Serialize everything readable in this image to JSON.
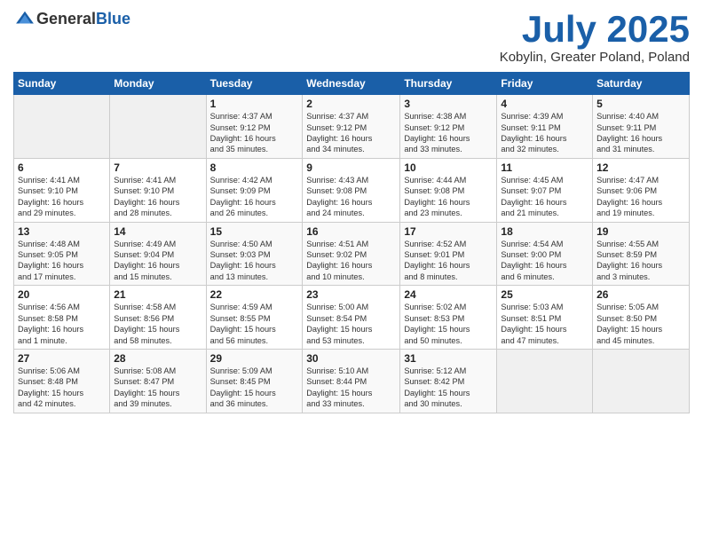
{
  "header": {
    "logo_general": "General",
    "logo_blue": "Blue",
    "month": "July 2025",
    "location": "Kobylin, Greater Poland, Poland"
  },
  "days_of_week": [
    "Sunday",
    "Monday",
    "Tuesday",
    "Wednesday",
    "Thursday",
    "Friday",
    "Saturday"
  ],
  "weeks": [
    [
      {
        "day": "",
        "info": ""
      },
      {
        "day": "",
        "info": ""
      },
      {
        "day": "1",
        "info": "Sunrise: 4:37 AM\nSunset: 9:12 PM\nDaylight: 16 hours\nand 35 minutes."
      },
      {
        "day": "2",
        "info": "Sunrise: 4:37 AM\nSunset: 9:12 PM\nDaylight: 16 hours\nand 34 minutes."
      },
      {
        "day": "3",
        "info": "Sunrise: 4:38 AM\nSunset: 9:12 PM\nDaylight: 16 hours\nand 33 minutes."
      },
      {
        "day": "4",
        "info": "Sunrise: 4:39 AM\nSunset: 9:11 PM\nDaylight: 16 hours\nand 32 minutes."
      },
      {
        "day": "5",
        "info": "Sunrise: 4:40 AM\nSunset: 9:11 PM\nDaylight: 16 hours\nand 31 minutes."
      }
    ],
    [
      {
        "day": "6",
        "info": "Sunrise: 4:41 AM\nSunset: 9:10 PM\nDaylight: 16 hours\nand 29 minutes."
      },
      {
        "day": "7",
        "info": "Sunrise: 4:41 AM\nSunset: 9:10 PM\nDaylight: 16 hours\nand 28 minutes."
      },
      {
        "day": "8",
        "info": "Sunrise: 4:42 AM\nSunset: 9:09 PM\nDaylight: 16 hours\nand 26 minutes."
      },
      {
        "day": "9",
        "info": "Sunrise: 4:43 AM\nSunset: 9:08 PM\nDaylight: 16 hours\nand 24 minutes."
      },
      {
        "day": "10",
        "info": "Sunrise: 4:44 AM\nSunset: 9:08 PM\nDaylight: 16 hours\nand 23 minutes."
      },
      {
        "day": "11",
        "info": "Sunrise: 4:45 AM\nSunset: 9:07 PM\nDaylight: 16 hours\nand 21 minutes."
      },
      {
        "day": "12",
        "info": "Sunrise: 4:47 AM\nSunset: 9:06 PM\nDaylight: 16 hours\nand 19 minutes."
      }
    ],
    [
      {
        "day": "13",
        "info": "Sunrise: 4:48 AM\nSunset: 9:05 PM\nDaylight: 16 hours\nand 17 minutes."
      },
      {
        "day": "14",
        "info": "Sunrise: 4:49 AM\nSunset: 9:04 PM\nDaylight: 16 hours\nand 15 minutes."
      },
      {
        "day": "15",
        "info": "Sunrise: 4:50 AM\nSunset: 9:03 PM\nDaylight: 16 hours\nand 13 minutes."
      },
      {
        "day": "16",
        "info": "Sunrise: 4:51 AM\nSunset: 9:02 PM\nDaylight: 16 hours\nand 10 minutes."
      },
      {
        "day": "17",
        "info": "Sunrise: 4:52 AM\nSunset: 9:01 PM\nDaylight: 16 hours\nand 8 minutes."
      },
      {
        "day": "18",
        "info": "Sunrise: 4:54 AM\nSunset: 9:00 PM\nDaylight: 16 hours\nand 6 minutes."
      },
      {
        "day": "19",
        "info": "Sunrise: 4:55 AM\nSunset: 8:59 PM\nDaylight: 16 hours\nand 3 minutes."
      }
    ],
    [
      {
        "day": "20",
        "info": "Sunrise: 4:56 AM\nSunset: 8:58 PM\nDaylight: 16 hours\nand 1 minute."
      },
      {
        "day": "21",
        "info": "Sunrise: 4:58 AM\nSunset: 8:56 PM\nDaylight: 15 hours\nand 58 minutes."
      },
      {
        "day": "22",
        "info": "Sunrise: 4:59 AM\nSunset: 8:55 PM\nDaylight: 15 hours\nand 56 minutes."
      },
      {
        "day": "23",
        "info": "Sunrise: 5:00 AM\nSunset: 8:54 PM\nDaylight: 15 hours\nand 53 minutes."
      },
      {
        "day": "24",
        "info": "Sunrise: 5:02 AM\nSunset: 8:53 PM\nDaylight: 15 hours\nand 50 minutes."
      },
      {
        "day": "25",
        "info": "Sunrise: 5:03 AM\nSunset: 8:51 PM\nDaylight: 15 hours\nand 47 minutes."
      },
      {
        "day": "26",
        "info": "Sunrise: 5:05 AM\nSunset: 8:50 PM\nDaylight: 15 hours\nand 45 minutes."
      }
    ],
    [
      {
        "day": "27",
        "info": "Sunrise: 5:06 AM\nSunset: 8:48 PM\nDaylight: 15 hours\nand 42 minutes."
      },
      {
        "day": "28",
        "info": "Sunrise: 5:08 AM\nSunset: 8:47 PM\nDaylight: 15 hours\nand 39 minutes."
      },
      {
        "day": "29",
        "info": "Sunrise: 5:09 AM\nSunset: 8:45 PM\nDaylight: 15 hours\nand 36 minutes."
      },
      {
        "day": "30",
        "info": "Sunrise: 5:10 AM\nSunset: 8:44 PM\nDaylight: 15 hours\nand 33 minutes."
      },
      {
        "day": "31",
        "info": "Sunrise: 5:12 AM\nSunset: 8:42 PM\nDaylight: 15 hours\nand 30 minutes."
      },
      {
        "day": "",
        "info": ""
      },
      {
        "day": "",
        "info": ""
      }
    ]
  ]
}
